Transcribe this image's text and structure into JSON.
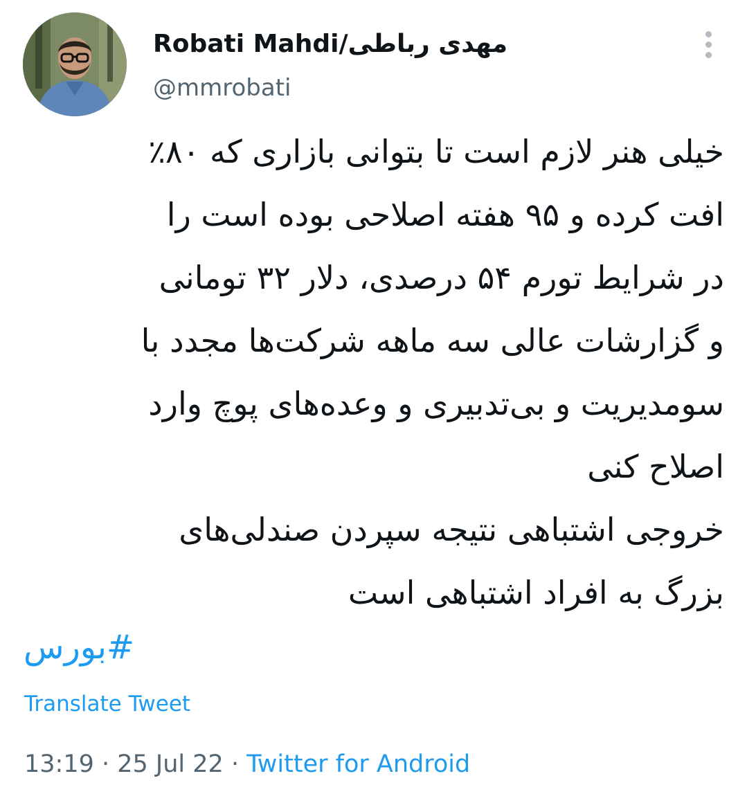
{
  "author": {
    "display_name": "Robati Mahdi/مهدی رباطی",
    "handle": "@mmrobati"
  },
  "tweet": {
    "lines": [
      "خیلی هنر لازم است تا بتوانی بازاری که ۸۰٪",
      "افت کرده و ۹۵ هفته اصلاحی بوده است را",
      "در شرایط تورم ۵۴ درصدی، دلار ۳۲ تومانی",
      "و گزارشات عالی سه ماهه شرکت‌ها مجدد با",
      "سومدیریت و بی‌تدبیری و وعده‌های پوچ وارد",
      "اصلاح کنی",
      "خروجی اشتباهی نتیجه سپردن صندلی‌های",
      "بزرگ به افراد اشتباهی است"
    ],
    "hashtag": "#بورس"
  },
  "translate_label": "Translate Tweet",
  "meta": {
    "time": "13:19",
    "separator": " · ",
    "date": "25 Jul 22",
    "source": "Twitter for Android"
  },
  "colors": {
    "link": "#1d9bf0",
    "secondary_text": "#536471",
    "primary_text": "#0f1419"
  },
  "icons": {
    "more": "more-vertical-icon"
  }
}
